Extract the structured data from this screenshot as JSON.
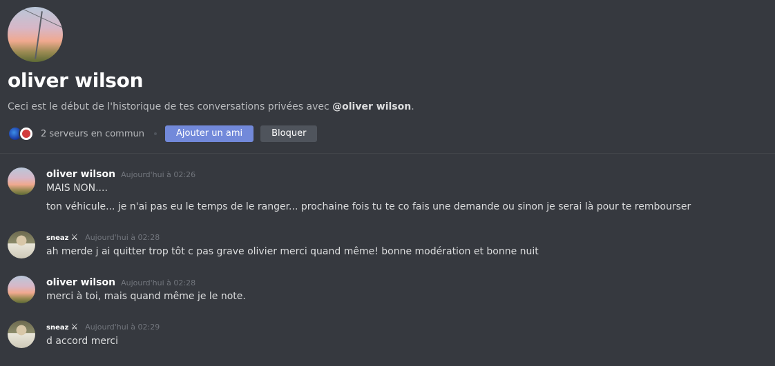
{
  "intro": {
    "name": "oliver wilson",
    "description_prefix": "Ceci est le début de l'historique de tes conversations privées avec ",
    "mention": "@oliver wilson",
    "description_suffix": ".",
    "mutual_servers": "2 serveurs en commun",
    "add_friend_label": "Ajouter un ami",
    "block_label": "Bloquer"
  },
  "messages": [
    {
      "author": "oliver wilson",
      "timestamp": "Aujourd'hui à 02:26",
      "lines": [
        "MAIS NON....",
        "ton véhicule... je n'ai pas eu le temps de le ranger... prochaine fois tu te co fais une demande ou sinon je serai là pour te rembourser"
      ]
    },
    {
      "author": "sneaz",
      "author_badge": "⚔",
      "timestamp": "Aujourd'hui à 02:28",
      "lines": [
        "ah merde j ai quitter trop tôt c pas grave olivier merci quand même! bonne modération et bonne nuit"
      ]
    },
    {
      "author": "oliver wilson",
      "timestamp": "Aujourd'hui à 02:28",
      "lines": [
        "merci à toi, mais quand même je le note."
      ]
    },
    {
      "author": "sneaz",
      "author_badge": "⚔",
      "timestamp": "Aujourd'hui à 02:29",
      "lines": [
        "d accord merci"
      ]
    }
  ],
  "colors": {
    "background": "#36393f",
    "accent": "#7289da",
    "secondary_button": "#4f545c",
    "muted_text": "#b9bbbe",
    "timestamp": "#72767d"
  },
  "icons": [
    "server-icon",
    "sword-icon"
  ]
}
